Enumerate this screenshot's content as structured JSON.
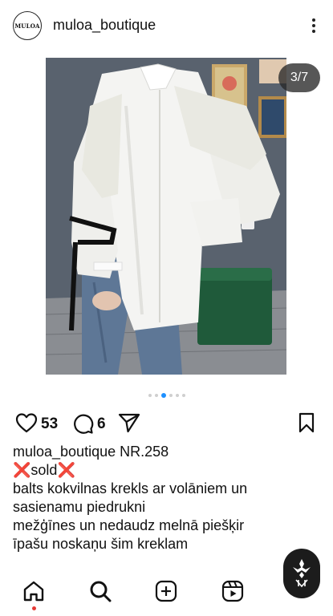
{
  "header": {
    "avatar_text": "MULOA",
    "username": "muloa_boutique",
    "more_icon": "more-vertical-icon"
  },
  "post": {
    "page_indicator": "3/7",
    "carousel": {
      "total": 7,
      "visible_dots": 6,
      "active_dot": 2
    },
    "likes": "53",
    "comments": "6"
  },
  "caption": {
    "username": "muloa_boutique",
    "first_line_text": "NR.258",
    "sold_text": "sold",
    "sold_mark": "❌",
    "lines": [
      "balts kokvilnas krekls ar volāniem un",
      "sasienamu piedrukni",
      "mežģīnes un nedaudz melnā piešķir",
      "īpašu noskaņu šim kreklam"
    ]
  },
  "nav": {
    "items": [
      "home-icon",
      "search-icon",
      "create-icon",
      "reels-icon"
    ]
  },
  "colors": {
    "accent_blue": "#1e90ff",
    "sold_red": "#e53935",
    "text": "#111111"
  }
}
